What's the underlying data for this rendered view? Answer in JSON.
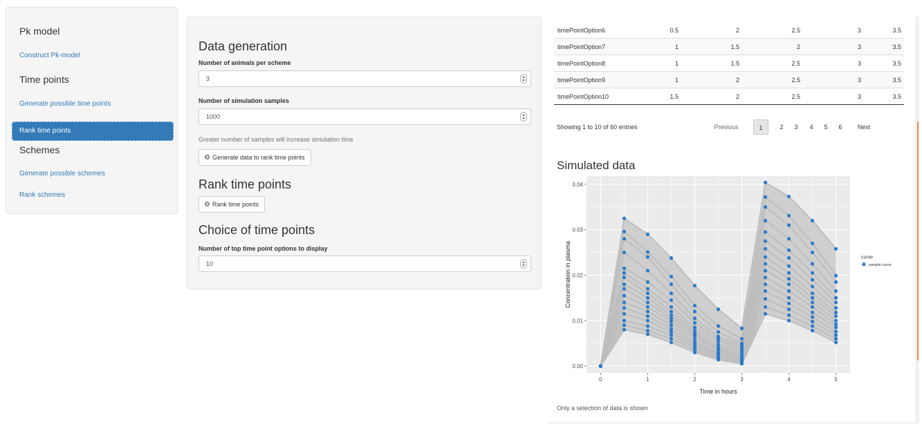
{
  "sidebar": {
    "pk_model_header": "Pk model",
    "construct_link": "Construct Pk-model",
    "time_points_header": "Time points",
    "generate_time_points_link": "Generate possible time points",
    "rank_time_points_link": "Rank time points",
    "schemes_header": "Schemes",
    "generate_schemes_link": "Generate possible schemes",
    "rank_schemes_link": "Rank schemes"
  },
  "main": {
    "data_generation_title": "Data generation",
    "animals_label": "Number of animals per scheme",
    "animals_value": "3",
    "samples_label": "Number of simulation samples",
    "samples_value": "1000",
    "samples_help": "Greater number of samples will increase simulation time",
    "generate_button": "Generate data to rank time points",
    "rank_title": "Rank time points",
    "rank_button": "Rank time points",
    "choice_title": "Choice of time points",
    "top_options_label": "Number of top time point options to display",
    "top_options_value": "10"
  },
  "table": {
    "rows": [
      {
        "name": "timePointOption6",
        "values": [
          "0.5",
          "2",
          "2.5",
          "3",
          "3.5"
        ]
      },
      {
        "name": "timePointOption7",
        "values": [
          "1",
          "1.5",
          "2",
          "3",
          "3.5"
        ]
      },
      {
        "name": "timePointOption8",
        "values": [
          "1",
          "1.5",
          "2.5",
          "3",
          "3.5"
        ]
      },
      {
        "name": "timePointOption9",
        "values": [
          "1",
          "2",
          "2.5",
          "3",
          "3.5"
        ]
      },
      {
        "name": "timePointOption10",
        "values": [
          "1.5",
          "2",
          "2.5",
          "3",
          "3.5"
        ]
      }
    ],
    "info": "Showing 1 to 10 of 60 entries",
    "pagination": {
      "previous": "Previous",
      "pages": [
        "1",
        "2",
        "3",
        "4",
        "5",
        "6"
      ],
      "current": "1",
      "next": "Next"
    }
  },
  "simulated": {
    "title": "Simulated data",
    "note": "Only a selection of data is shown"
  },
  "chart_data": {
    "type": "scatter",
    "title": "",
    "xlabel": "Time in hours",
    "ylabel": "Concentration in plasma",
    "xlim": [
      -0.3,
      5.3
    ],
    "ylim": [
      -0.0015,
      0.0418
    ],
    "x_ticks": [
      "0",
      "1",
      "2",
      "3",
      "4",
      "5"
    ],
    "y_ticks": [
      "0.00",
      "0.01",
      "0.02",
      "0.03",
      "0.04"
    ],
    "grid": true,
    "legend": {
      "title": "curve",
      "entries": [
        "sample curve"
      ],
      "placement": "right"
    },
    "colors": {
      "points": "#2b7bcb",
      "lines": "#bdbdbd",
      "panel": "#ebebeb",
      "grid": "#ffffff"
    },
    "x": [
      0,
      0.5,
      1,
      1.5,
      2,
      2.5,
      3,
      3.5,
      4,
      4.5,
      5
    ],
    "series": [
      {
        "values": [
          0,
          0.0325,
          0.029,
          0.0238,
          0.0177,
          0.0125,
          0.0083,
          0.0404,
          0.0373,
          0.032,
          0.0258
        ]
      },
      {
        "values": [
          0,
          0.0296,
          0.0251,
          0.0197,
          0.0133,
          0.0088,
          0.006,
          0.0372,
          0.0331,
          0.027,
          0.0199
        ]
      },
      {
        "values": [
          0,
          0.028,
          0.024,
          0.018,
          0.012,
          0.0075,
          0.005,
          0.035,
          0.031,
          0.025,
          0.0185
        ]
      },
      {
        "values": [
          0,
          0.025,
          0.021,
          0.016,
          0.0105,
          0.0065,
          0.0045,
          0.032,
          0.028,
          0.0225,
          0.0165
        ]
      },
      {
        "values": [
          0,
          0.0215,
          0.0185,
          0.0145,
          0.0095,
          0.006,
          0.004,
          0.0295,
          0.0255,
          0.0205,
          0.015
        ]
      },
      {
        "values": [
          0,
          0.0205,
          0.017,
          0.013,
          0.0085,
          0.0055,
          0.0035,
          0.0275,
          0.0238,
          0.019,
          0.014
        ]
      },
      {
        "values": [
          0,
          0.0195,
          0.016,
          0.012,
          0.0078,
          0.0048,
          0.003,
          0.0258,
          0.022,
          0.0175,
          0.0128
        ]
      },
      {
        "values": [
          0,
          0.018,
          0.015,
          0.0112,
          0.0072,
          0.0042,
          0.0025,
          0.024,
          0.0205,
          0.016,
          0.0118
        ]
      },
      {
        "values": [
          0,
          0.017,
          0.014,
          0.0105,
          0.0068,
          0.0038,
          0.0022,
          0.0225,
          0.0192,
          0.015,
          0.011
        ]
      },
      {
        "values": [
          0,
          0.0155,
          0.013,
          0.0098,
          0.0062,
          0.0035,
          0.002,
          0.021,
          0.018,
          0.014,
          0.01
        ]
      },
      {
        "values": [
          0,
          0.014,
          0.012,
          0.009,
          0.0055,
          0.003,
          0.0018,
          0.0195,
          0.0165,
          0.013,
          0.0092
        ]
      },
      {
        "values": [
          0,
          0.0128,
          0.011,
          0.0082,
          0.005,
          0.0027,
          0.0015,
          0.018,
          0.015,
          0.0118,
          0.0085
        ]
      },
      {
        "values": [
          0,
          0.0115,
          0.01,
          0.0075,
          0.0045,
          0.0024,
          0.0013,
          0.0165,
          0.0138,
          0.0108,
          0.0076
        ]
      },
      {
        "values": [
          0,
          0.01,
          0.0088,
          0.0068,
          0.004,
          0.002,
          0.001,
          0.0148,
          0.0125,
          0.0098,
          0.0068
        ]
      },
      {
        "values": [
          0,
          0.009,
          0.0078,
          0.006,
          0.0035,
          0.0017,
          0.0008,
          0.013,
          0.0112,
          0.0088,
          0.006
        ]
      },
      {
        "values": [
          0,
          0.008,
          0.007,
          0.0052,
          0.003,
          0.0014,
          0.0005,
          0.0115,
          0.01,
          0.0078,
          0.0052
        ]
      }
    ]
  }
}
